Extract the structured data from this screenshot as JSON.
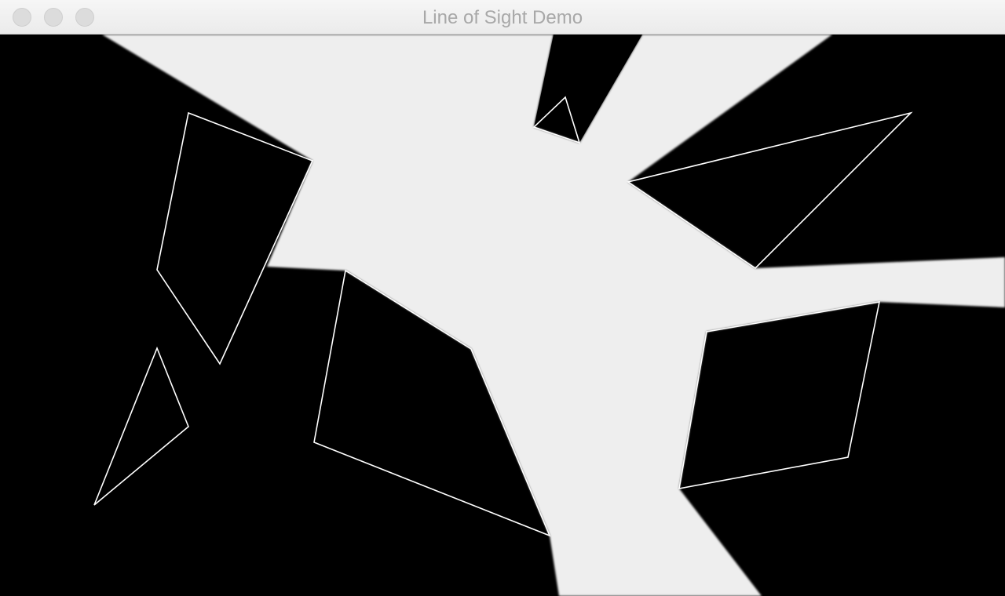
{
  "window": {
    "title": "Line of Sight Demo",
    "buttons": [
      "close",
      "minimize",
      "zoom"
    ]
  },
  "scene": {
    "background_color": "#000000",
    "light_color": "#eeeeee",
    "outline_color": "#ffffff"
  }
}
